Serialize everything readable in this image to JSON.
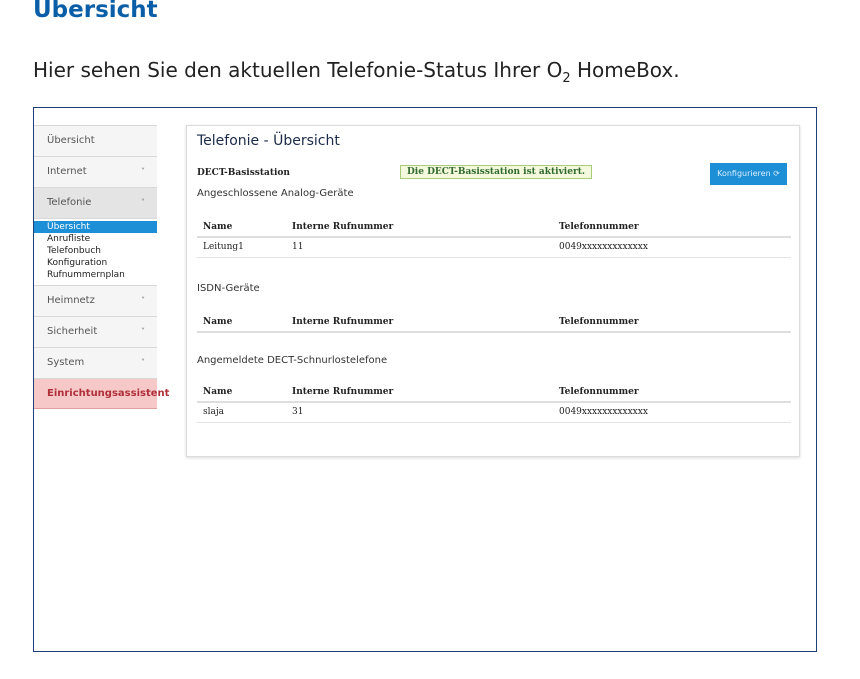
{
  "doc": {
    "title": "Übersicht",
    "intro_before": "Hier sehen Sie den aktuellen Telefonie-Status Ihrer O",
    "intro_sub": "2",
    "intro_after": " HomeBox."
  },
  "sidebar": {
    "overview": "Übersicht",
    "internet": "Internet",
    "telefonie": "Telefonie",
    "telefonie_sub": [
      "Übersicht",
      "Anrufliste",
      "Telefonbuch",
      "Konfiguration",
      "Rufnummernplan"
    ],
    "heimnetz": "Heimnetz",
    "sicherheit": "Sicherheit",
    "system": "System",
    "assistant": "Einrichtungsassistent",
    "chevron": "˅"
  },
  "panel": {
    "title": "Telefonie - Übersicht",
    "dect_label": "DECT-Basisstation",
    "dect_status": "Die DECT-Basisstation ist aktiviert.",
    "config_button": "Konfigurieren ⟳",
    "columns": [
      "Name",
      "Interne Rufnummer",
      "Telefonnummer"
    ],
    "analog": {
      "title": "Angeschlossene Analog-Geräte",
      "rows": [
        {
          "name": "Leitung1",
          "internal": "11",
          "phone": "0049xxxxxxxxxxxxx"
        }
      ]
    },
    "isdn": {
      "title": "ISDN-Geräte"
    },
    "dect": {
      "title": "Angemeldete DECT-Schnurlostelefone",
      "rows": [
        {
          "name": "slaja",
          "internal": "31",
          "phone": "0049xxxxxxxxxxxxx"
        }
      ]
    }
  },
  "colors": {
    "accent": "#1d8fd6",
    "title_blue": "#0a5ea8",
    "assistant_bg": "#f6c8c8"
  }
}
